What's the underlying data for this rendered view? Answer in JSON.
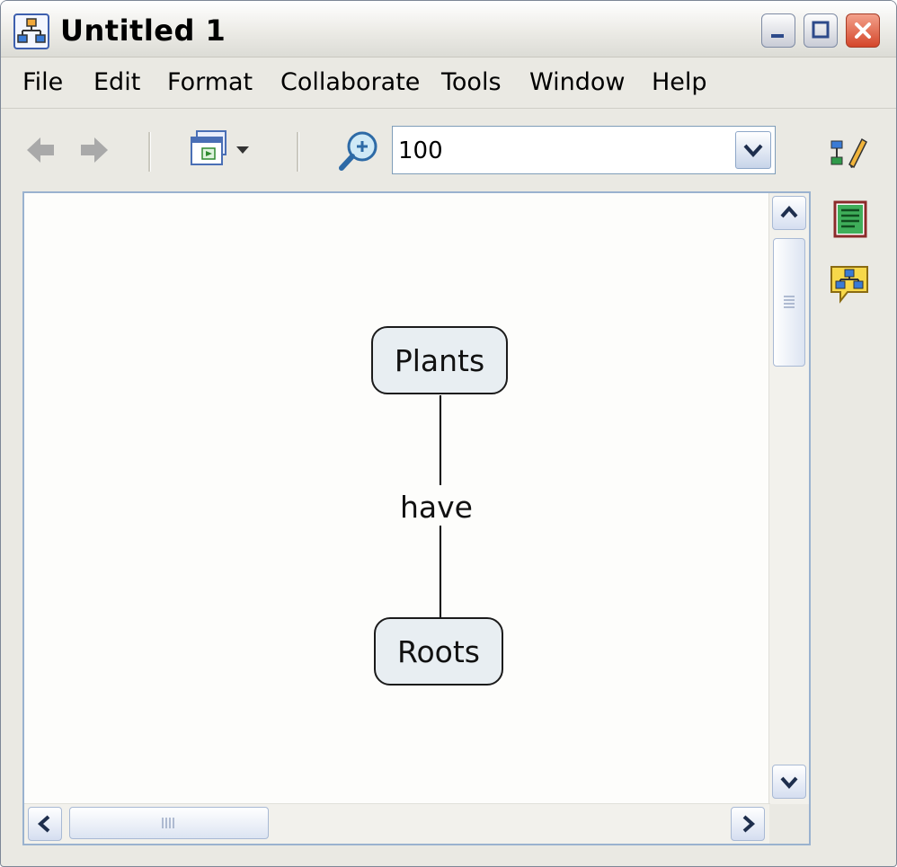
{
  "window": {
    "title": "Untitled 1"
  },
  "menu": {
    "items": [
      "File",
      "Edit",
      "Format",
      "Collaborate",
      "Tools",
      "Window",
      "Help"
    ]
  },
  "toolbar": {
    "zoom": {
      "value": "100"
    },
    "icons": [
      "back-arrow-icon",
      "forward-arrow-icon",
      "view-dropdown-icon",
      "zoom-icon"
    ]
  },
  "sidebar": {
    "icons": [
      "concept-map-edit-icon",
      "document-list-icon",
      "map-discussion-icon"
    ]
  },
  "concept_map": {
    "nodes": [
      {
        "label": "Plants"
      },
      {
        "label": "Roots"
      }
    ],
    "links": [
      {
        "label": "have"
      }
    ]
  },
  "colors": {
    "node_fill": "#e8eef2",
    "node_border": "#1b1b1b",
    "canvas_background": "#fdfdfb",
    "window_chrome": "#eae9e3",
    "close_button": "#d4462a"
  }
}
